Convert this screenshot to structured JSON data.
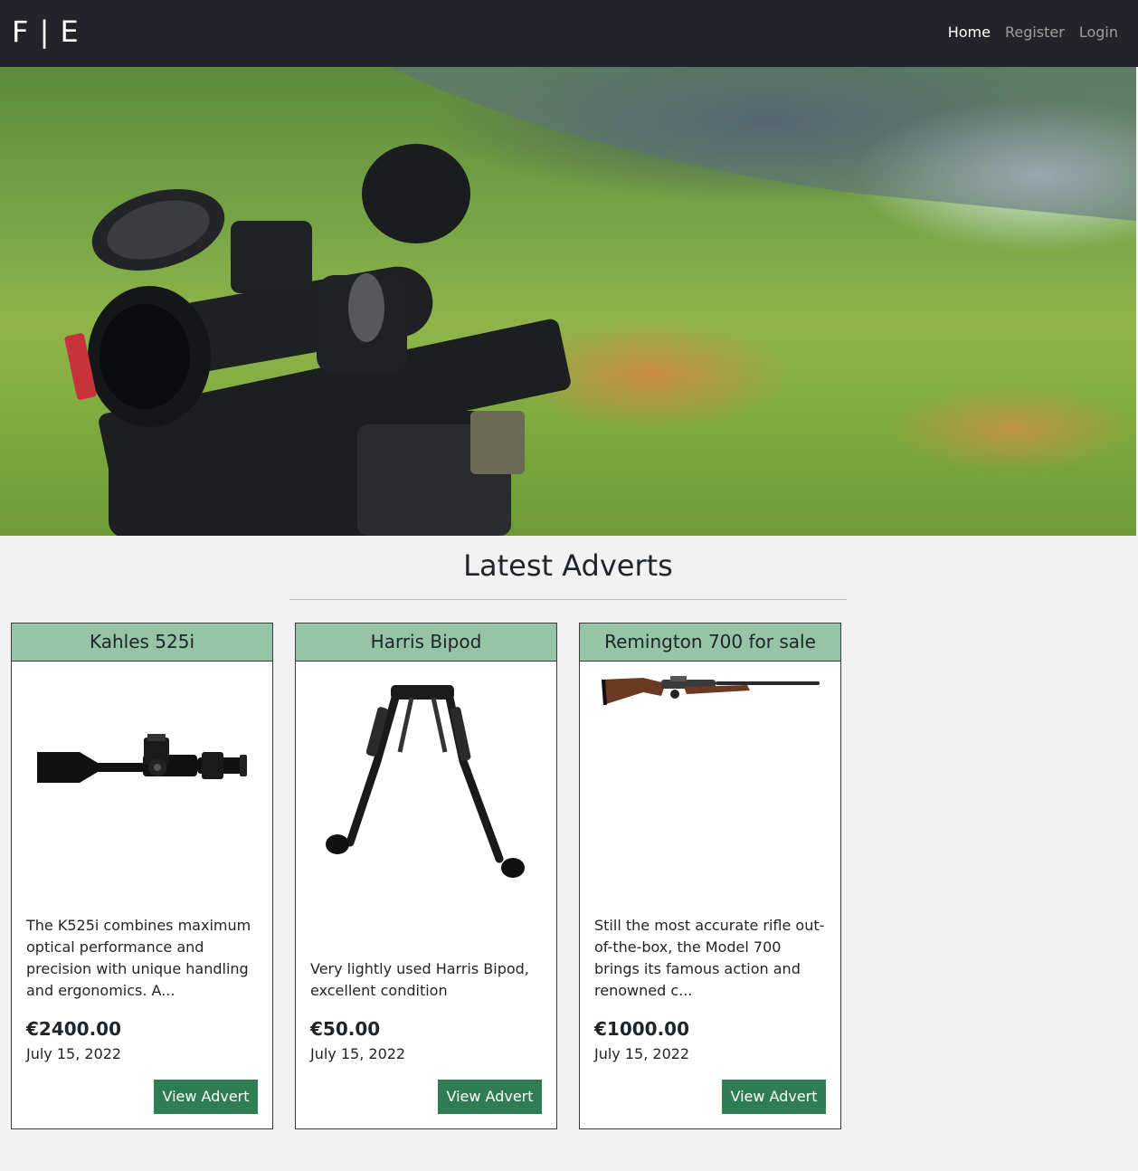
{
  "brand": "F | E",
  "nav": {
    "home": "Home",
    "register": "Register",
    "login": "Login"
  },
  "section_title": "Latest Adverts",
  "cards": [
    {
      "title": "Kahles 525i",
      "description": "The K525i combines maximum optical performance and precision with unique handling and ergonomics. A...",
      "price": "€2400.00",
      "date": "July 15, 2022",
      "button": "View Advert",
      "image": "rifle-scope-image"
    },
    {
      "title": "Harris Bipod",
      "description": "Very lightly used Harris Bipod, excellent condition",
      "price": "€50.00",
      "date": "July 15, 2022",
      "button": "View Advert",
      "image": "bipod-image"
    },
    {
      "title": "Remington 700 for sale",
      "description": "Still the most accurate rifle out-of-the-box, the Model 700 brings its famous action and renowned c...",
      "price": "€1000.00",
      "date": "July 15, 2022",
      "button": "View Advert",
      "image": "rifle-image"
    }
  ],
  "colors": {
    "navbar": "#212529",
    "card_header": "#95c4a7",
    "button": "#2f7d52",
    "background": "#f2f2f2"
  }
}
